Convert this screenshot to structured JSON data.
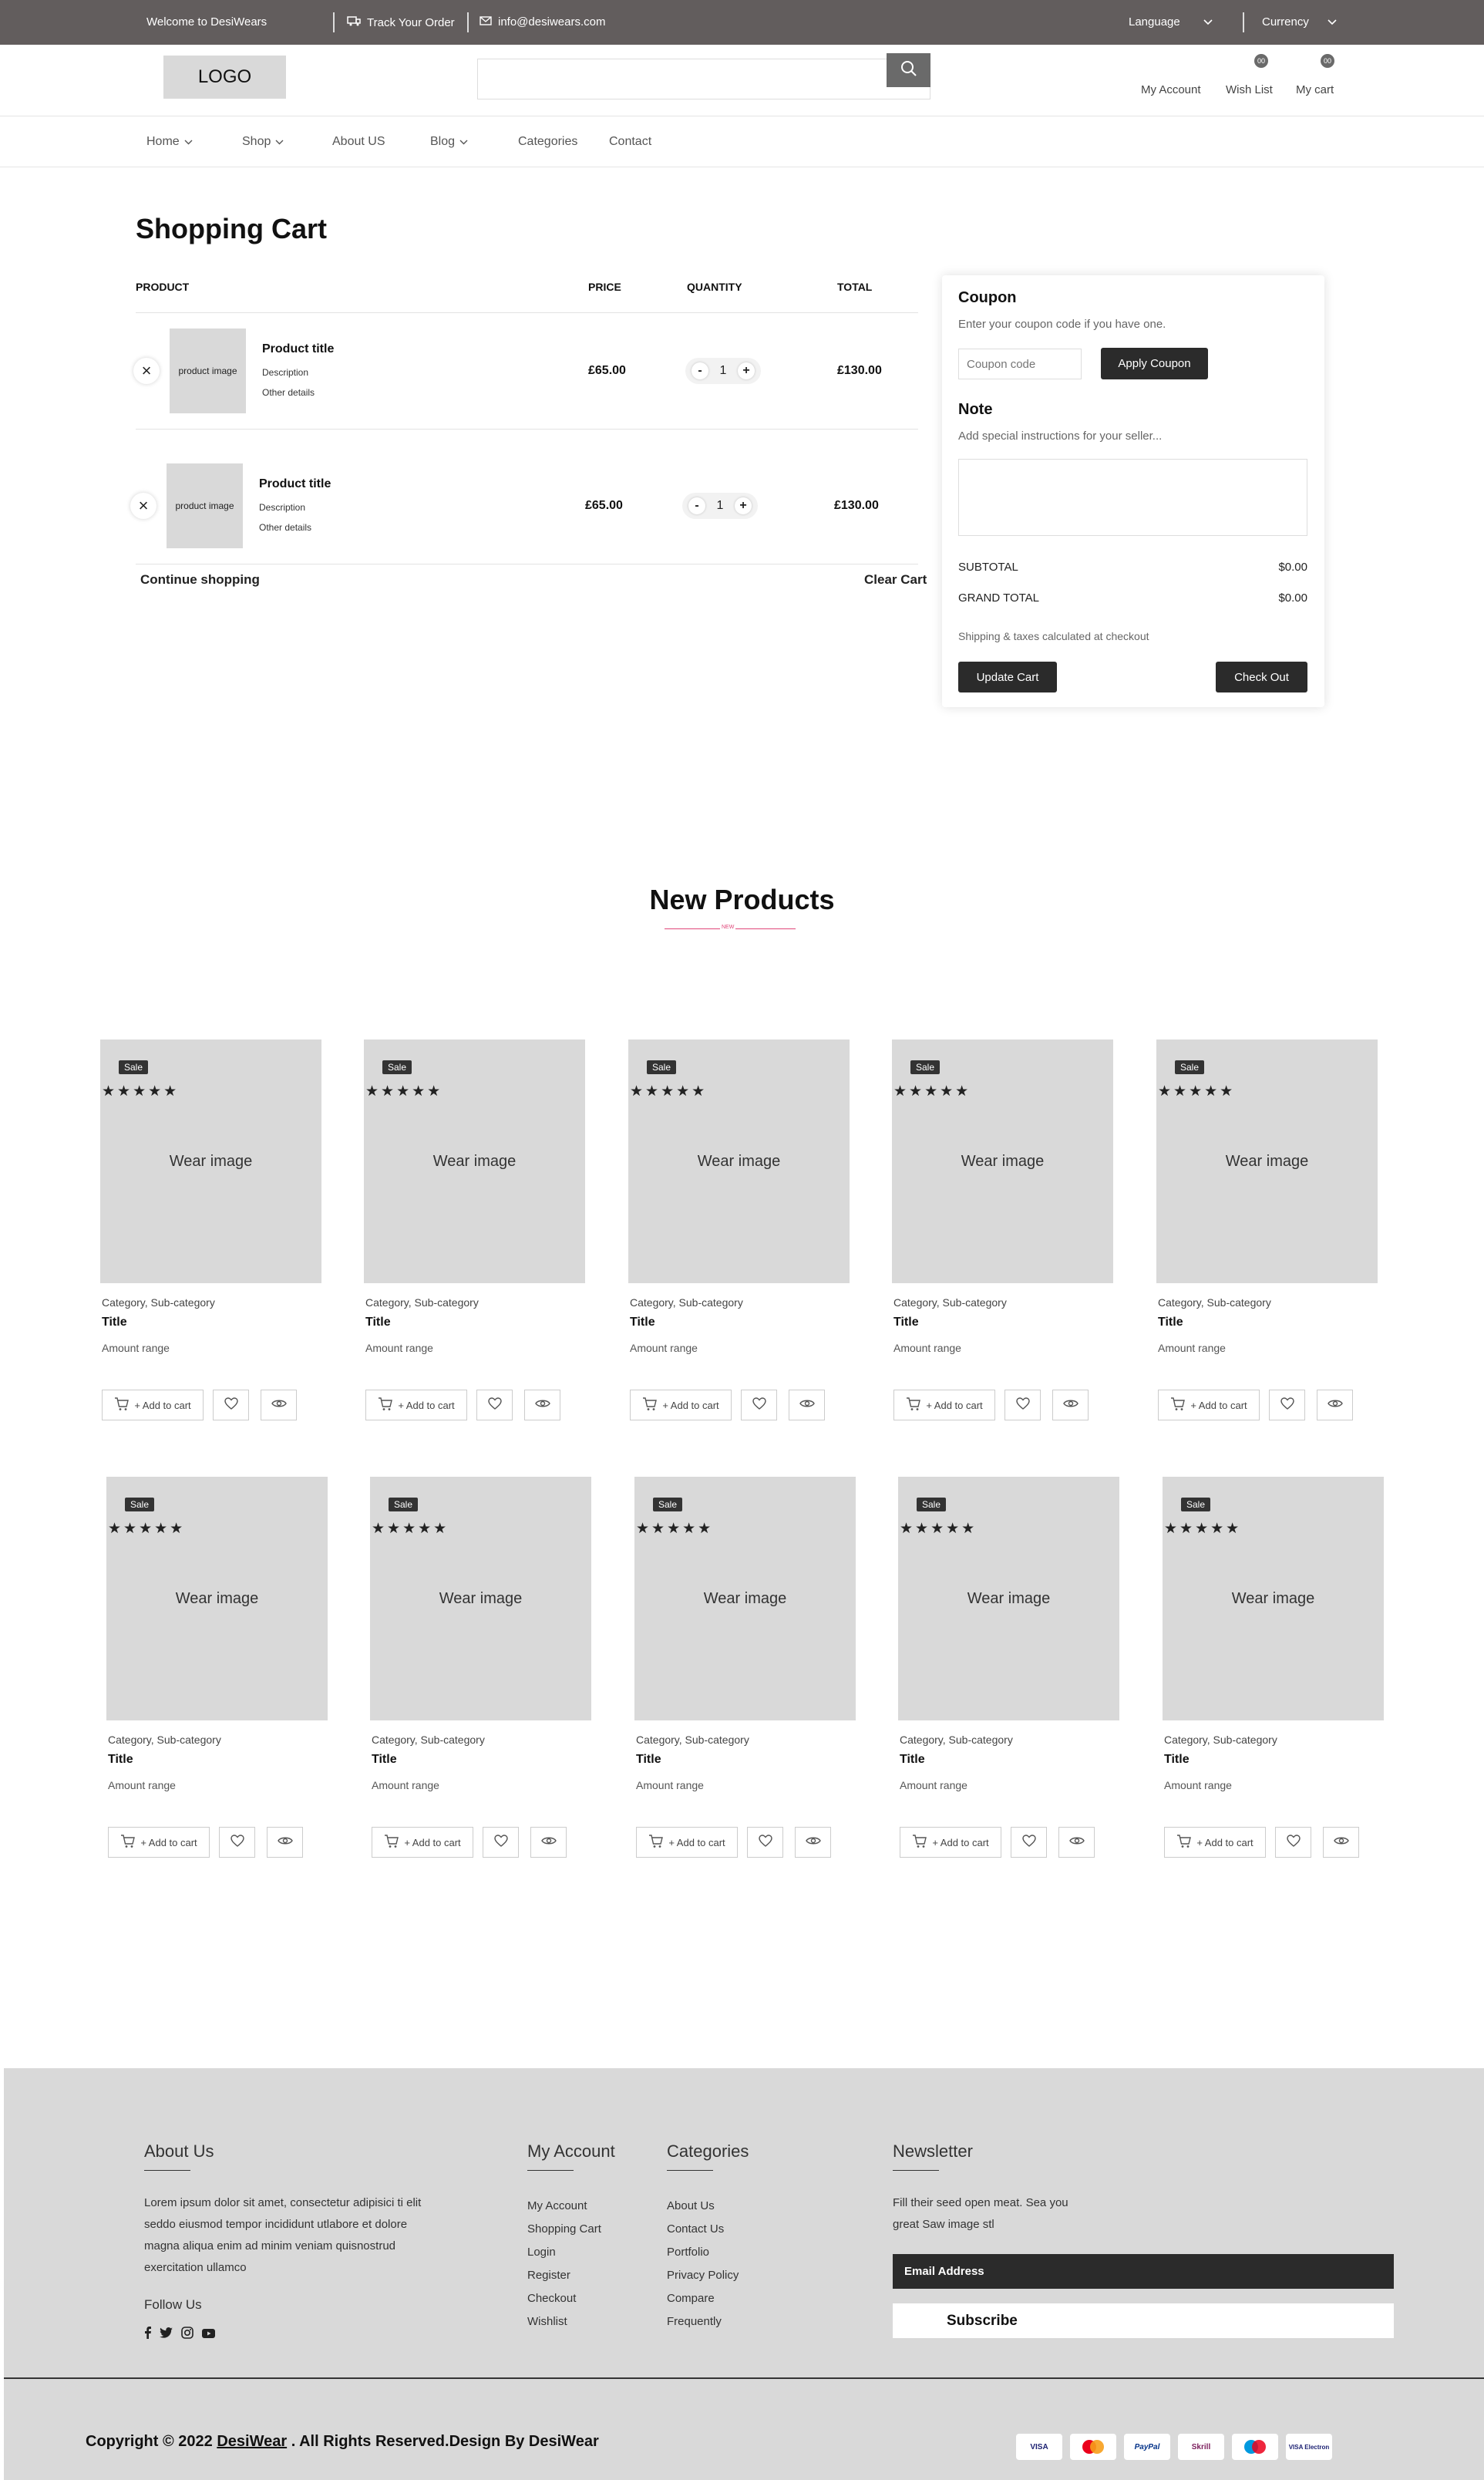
{
  "topbar": {
    "welcome": "Welcome to DesiWears",
    "track_order": "Track Your Order",
    "email": "info@desiwears.com",
    "language": "Language",
    "currency": "Currency"
  },
  "header": {
    "logo": "LOGO",
    "search_placeholder": "",
    "my_account": "My Account",
    "wish_list": "Wish List",
    "my_cart": "My cart",
    "wish_count": "00",
    "cart_count": "00"
  },
  "nav": {
    "home": "Home",
    "shop": "Shop",
    "about": "About US",
    "blog": "Blog",
    "categories": "Categories",
    "contact": "Contact"
  },
  "cart": {
    "title": "Shopping Cart",
    "headers": {
      "product": "PRODUCT",
      "price": "PRICE",
      "quantity": "QUANTITY",
      "total": "TOTAL"
    },
    "items": [
      {
        "image": "product image",
        "title": "Product title",
        "description": "Description",
        "details": "Other details",
        "price": "£65.00",
        "qty": "1",
        "total": "£130.00"
      },
      {
        "image": "product image",
        "title": "Product title",
        "description": "Description",
        "details": "Other details",
        "price": "£65.00",
        "qty": "1",
        "total": "£130.00"
      }
    ],
    "continue": "Continue shopping",
    "clear": "Clear Cart"
  },
  "sidebar": {
    "coupon_title": "Coupon",
    "coupon_text": "Enter your coupon code if you have one.",
    "coupon_placeholder": "Coupon code",
    "apply": "Apply Coupon",
    "note_title": "Note",
    "note_text": "Add special instructions for your seller...",
    "subtotal_label": "SUBTOTAL",
    "subtotal_value": "$0.00",
    "grand_label": "GRAND TOTAL",
    "grand_value": "$0.00",
    "shipping_note": "Shipping & taxes calculated at checkout",
    "update": "Update Cart",
    "checkout": "Check Out"
  },
  "new_products": {
    "title": "New Products",
    "divider_text": "NEW",
    "products": [
      {
        "badge": "Sale",
        "stars": "★★★★★",
        "image": "Wear image",
        "category": "Category, Sub-category",
        "title": "Title",
        "amount": "Amount range",
        "add": "+ Add to cart"
      },
      {
        "badge": "Sale",
        "stars": "★★★★★",
        "image": "Wear image",
        "category": "Category, Sub-category",
        "title": "Title",
        "amount": "Amount range",
        "add": "+ Add to cart"
      },
      {
        "badge": "Sale",
        "stars": "★★★★★",
        "image": "Wear image",
        "category": "Category, Sub-category",
        "title": "Title",
        "amount": "Amount range",
        "add": "+ Add to cart"
      },
      {
        "badge": "Sale",
        "stars": "★★★★★",
        "image": "Wear image",
        "category": "Category, Sub-category",
        "title": "Title",
        "amount": "Amount range",
        "add": "+ Add to cart"
      },
      {
        "badge": "Sale",
        "stars": "★★★★★",
        "image": "Wear image",
        "category": "Category, Sub-category",
        "title": "Title",
        "amount": "Amount range",
        "add": "+ Add to cart"
      },
      {
        "badge": "Sale",
        "stars": "★★★★★",
        "image": "Wear image",
        "category": "Category, Sub-category",
        "title": "Title",
        "amount": "Amount range",
        "add": "+ Add to cart"
      },
      {
        "badge": "Sale",
        "stars": "★★★★★",
        "image": "Wear image",
        "category": "Category, Sub-category",
        "title": "Title",
        "amount": "Amount range",
        "add": "+ Add to cart"
      },
      {
        "badge": "Sale",
        "stars": "★★★★★",
        "image": "Wear image",
        "category": "Category, Sub-category",
        "title": "Title",
        "amount": "Amount range",
        "add": "+ Add to cart"
      },
      {
        "badge": "Sale",
        "stars": "★★★★★",
        "image": "Wear image",
        "category": "Category, Sub-category",
        "title": "Title",
        "amount": "Amount range",
        "add": "+ Add to cart"
      },
      {
        "badge": "Sale",
        "stars": "★★★★★",
        "image": "Wear image",
        "category": "Category, Sub-category",
        "title": "Title",
        "amount": "Amount range",
        "add": "+ Add to cart"
      }
    ]
  },
  "footer": {
    "about_title": "About Us",
    "about_text_1": "Lorem ipsum dolor sit amet, consectetur adipisici ti elit",
    "about_text_2": "seddo eiusmod tempor incididunt utlabore et dolore",
    "about_text_3": "magna aliqua enim ad minim veniam quisnostrud",
    "about_text_4": "exercitation ullamco",
    "follow": "Follow Us",
    "account_title": "My Account",
    "account_links": [
      "My Account",
      "Shopping Cart",
      "Login",
      "Register",
      "Checkout",
      "Wishlist"
    ],
    "categories_title": "Categories",
    "category_links": [
      "About Us",
      "Contact Us",
      "Portfolio",
      "Privacy Policy",
      "Compare",
      "Frequently"
    ],
    "newsletter_title": "Newsletter",
    "newsletter_text_1": "Fill their seed open meat. Sea you",
    "newsletter_text_2": "great Saw image stl",
    "email_label": "Email Address",
    "subscribe": "Subscribe",
    "copyright_pre": "Copyright © 2022",
    "copyright_brand": "DesiWear",
    "copyright_post": ". All Rights Reserved.Design By DesiWear",
    "payments": [
      "VISA",
      "MC",
      "PayPal",
      "Skrill",
      "Maestro",
      "VISA Electron"
    ]
  }
}
